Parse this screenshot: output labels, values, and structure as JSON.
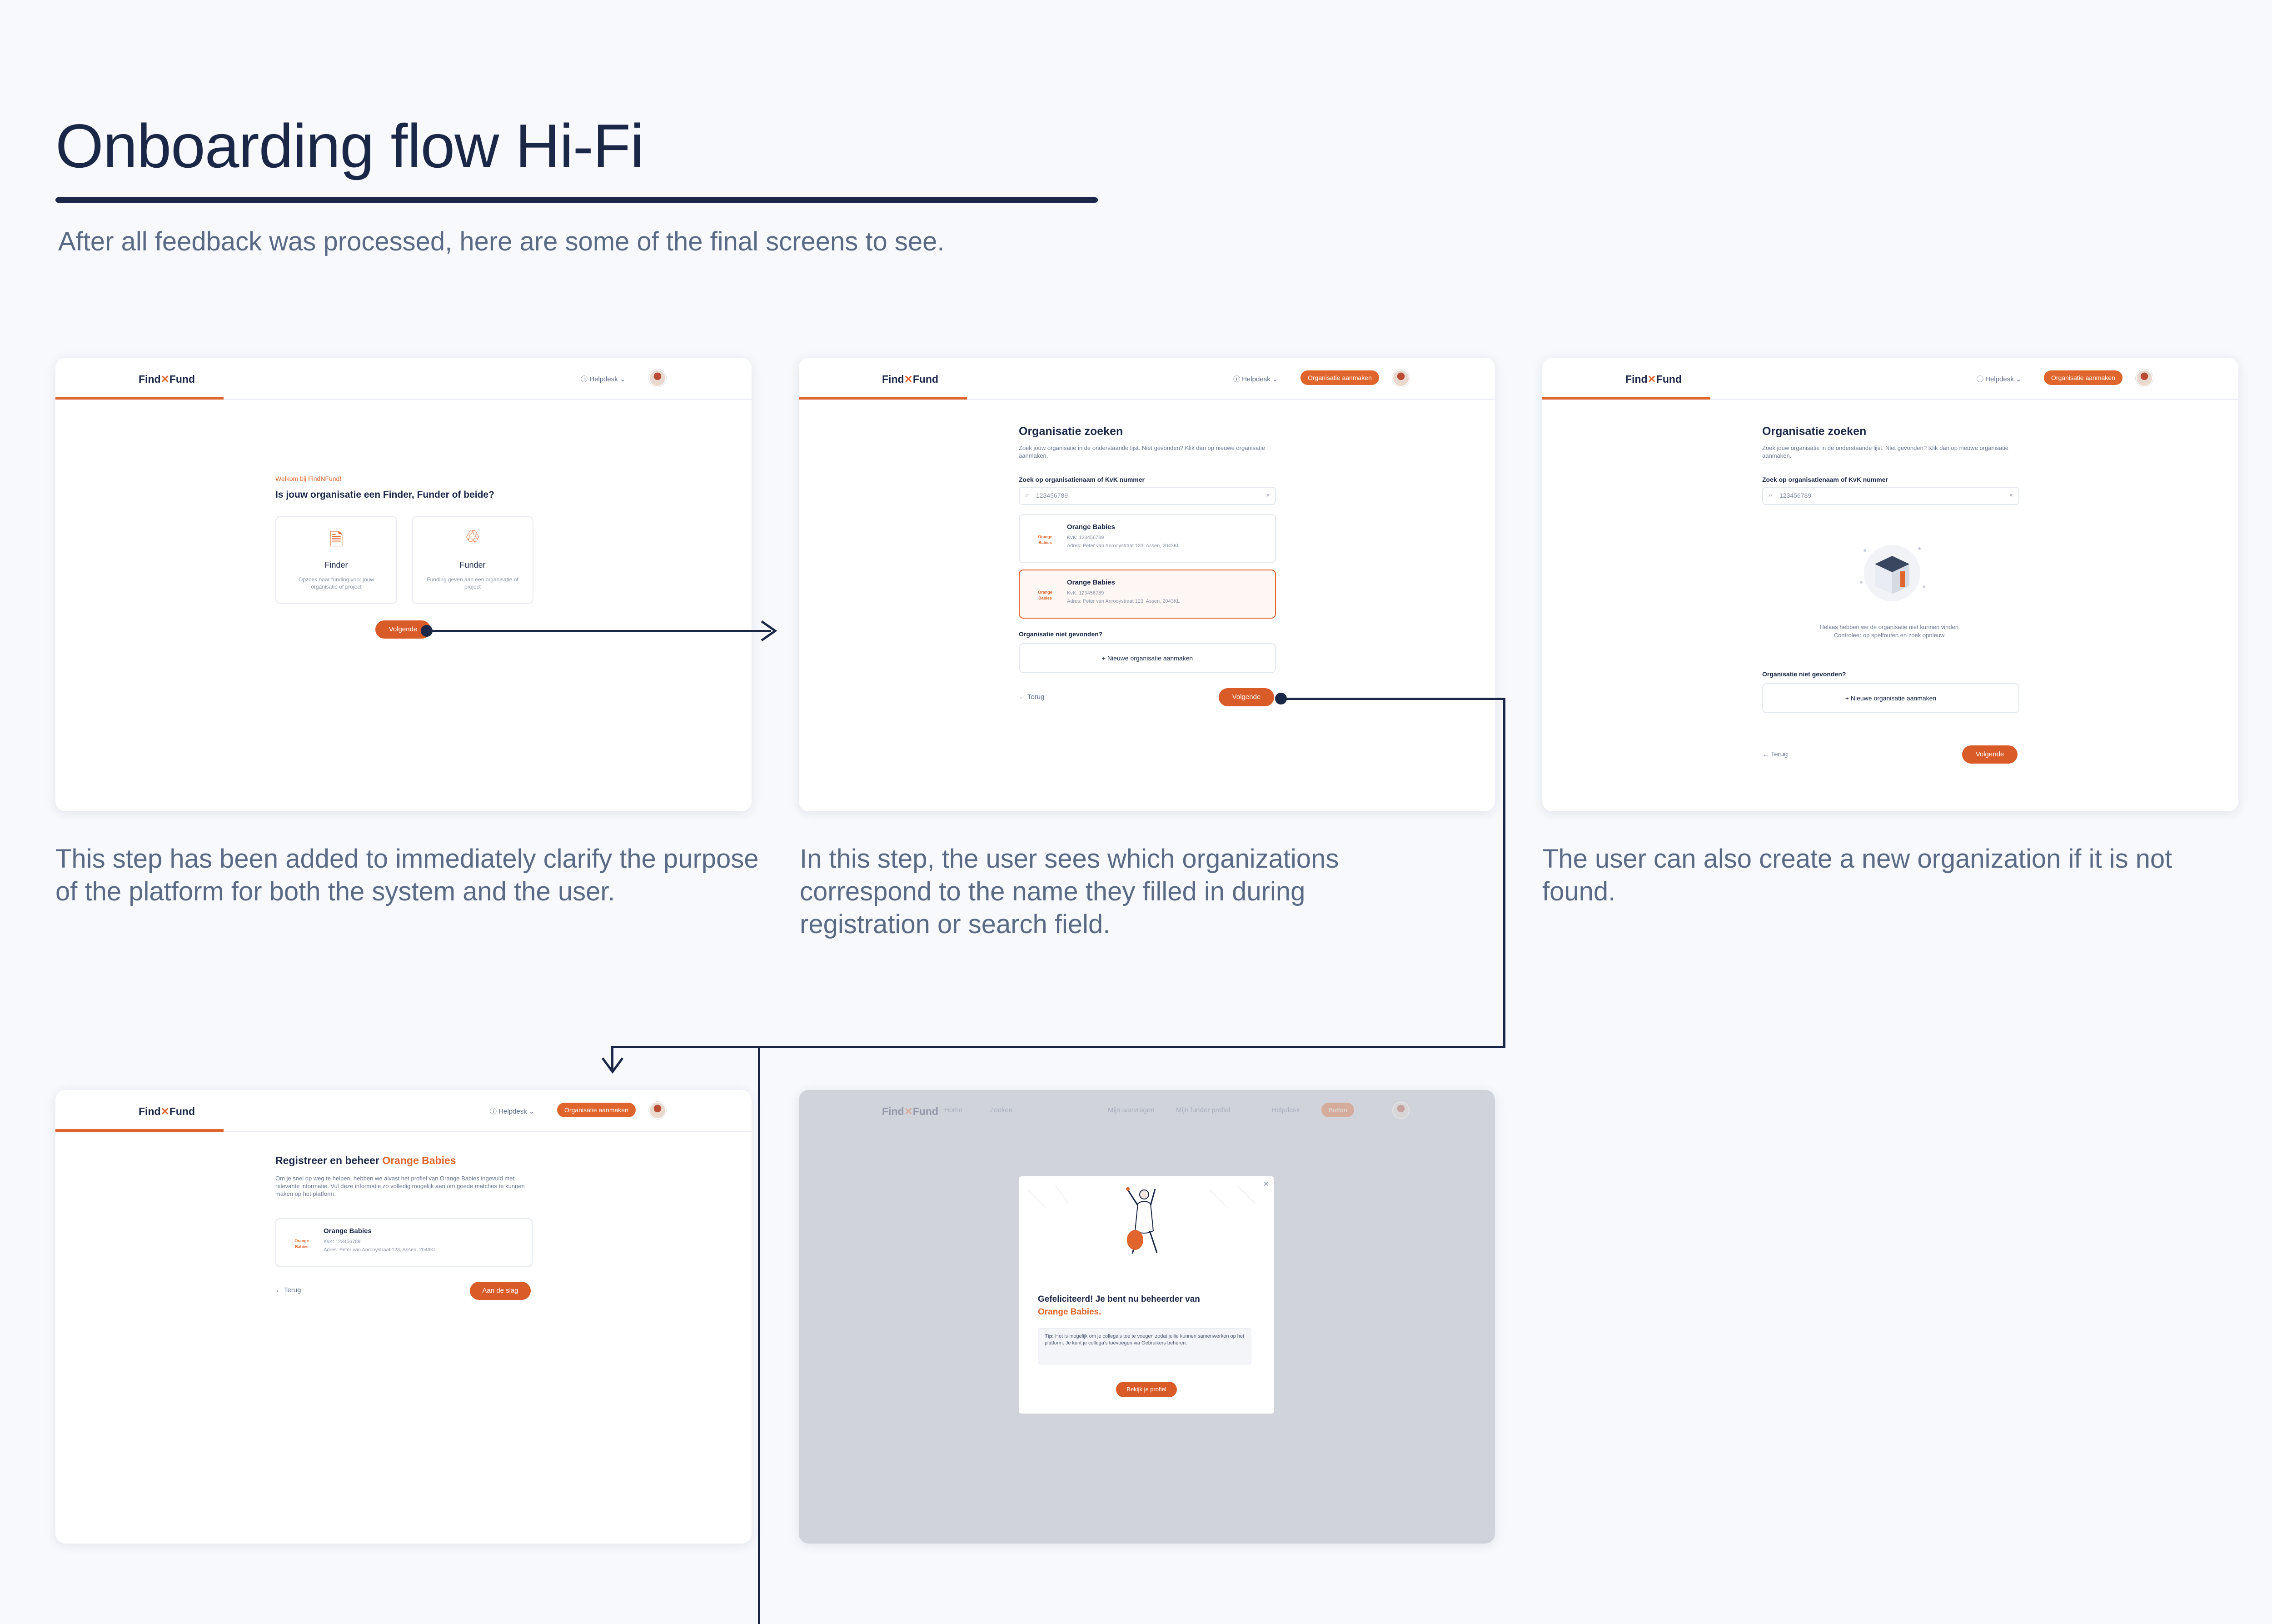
{
  "header": {
    "title": "Onboarding flow Hi-Fi",
    "subtitle": "After all feedback was processed, here are some of the final screens to see."
  },
  "captions": [
    "This step has been added to immediately clarify the purpose of the platform for both the system and the user.",
    "In this step, the user sees which organizations correspond to the name they filled in during registration or search field.",
    "The user can also create a new organization if it is not found."
  ],
  "app": {
    "logo_left": "Find",
    "logo_mid": "✕",
    "logo_right": "Fund",
    "helpdesk": "Helpdesk",
    "create_org": "Organisatie aanmaken",
    "next": "Volgende",
    "back": "← Terug"
  },
  "screen1": {
    "welcome": "Welkom bij FindNFund!",
    "question": "Is jouw organisatie een Finder, Funder of beide?",
    "finder_title": "Finder",
    "finder_desc": "Opzoek naar funding voor jouw organisatie of project",
    "funder_title": "Funder",
    "funder_desc": "Funding geven aan een organisatie of project"
  },
  "screen2": {
    "title": "Organisatie zoeken",
    "desc": "Zoek jouw organisatie in de onderstaande lijst. Niet gevonden? Klik dan op nieuwe organisatie aanmaken.",
    "search_label": "Zoek op organisatienaam of KvK nummer",
    "search_value": "123456789",
    "results": [
      {
        "name": "Orange Babies",
        "kvk": "KvK: 123456789",
        "address": "Adres: Peter van Anrooystraat 123, Assen, 2043KL",
        "badge": "Orange Babies"
      },
      {
        "name": "Orange Babies",
        "kvk": "KvK: 123456789",
        "address": "Adres: Peter van Anrooystraat 123, Assen, 2043KL",
        "badge": "Orange Babies"
      }
    ],
    "not_found": "Organisatie niet gevonden?",
    "new_org": "+ Nieuwe organisatie aanmaken"
  },
  "screen3": {
    "title": "Organisatie zoeken",
    "desc": "Zoek jouw organisatie in de onderstaande lijst. Niet gevonden? Klik dan op nieuwe organisatie aanmaken.",
    "search_label": "Zoek op organisatienaam of KvK nummer",
    "search_value": "123456789",
    "empty_line1": "Helaas hebben we de organisatie niet kunnen vinden.",
    "empty_line2": "Controleer op spelfouten en zoek opnieuw.",
    "not_found": "Organisatie niet gevonden?",
    "new_org": "+ Nieuwe organisatie aanmaken"
  },
  "screen4": {
    "title_prefix": "Registreer en beheer ",
    "title_org": "Orange Babies",
    "desc": "Om je snel op weg te helpen, hebben we alvast het profiel van Orange Babies ingevuld met relevante informatie. Vul deze informatie zo volledig mogelijk aan om goede matches te kunnen maken op het platform.",
    "card": {
      "name": "Orange Babies",
      "kvk": "KvK: 123456789",
      "address": "Adres: Peter van Anrooystraat 123, Assen, 2043KL",
      "badge": "Orange Babies"
    },
    "cta": "Aan de slag"
  },
  "screen5": {
    "nav": [
      "Home",
      "Zoeken",
      "Mijn aanvragen",
      "Mijn funder profiel",
      "Helpdesk",
      "Button"
    ],
    "modal_title_1": "Gefeliciteerd! Je bent nu beheerder van",
    "modal_title_2": "Orange Babies.",
    "tip_label": "Tip:",
    "tip_text": " Het is mogelijk om je collega's toe te voegen zodat jullie kunnen samenwerken op het platform. Je kunt je collega's toevoegen via Gebruikers beheren.",
    "cta": "Bekijk je profiel",
    "close": "×"
  },
  "colors": {
    "brand_orange": "#e0652c",
    "navy": "#1b2747",
    "background": "#f7f9fc"
  }
}
